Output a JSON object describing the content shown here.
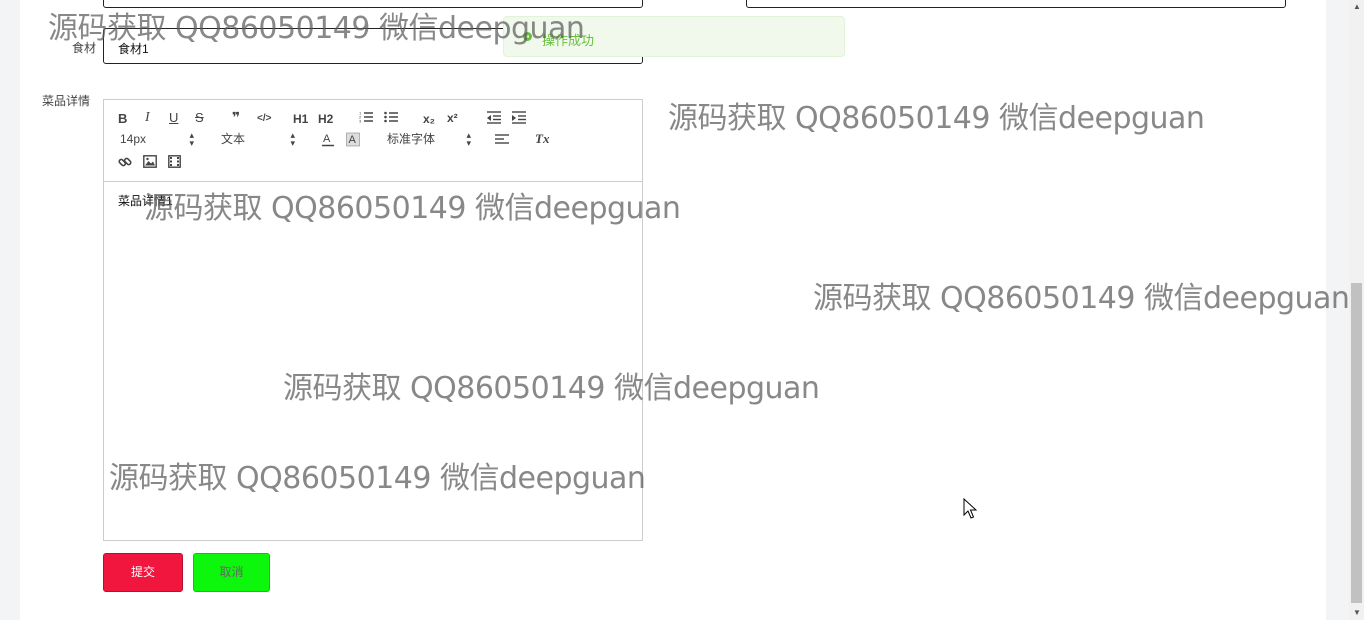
{
  "form": {
    "ingredient_label": "食材",
    "ingredient_value": "食材1",
    "details_label": "菜品详情",
    "editor_content": "菜品详情1"
  },
  "toolbar": {
    "bold": "B",
    "italic": "I",
    "underline": "U",
    "strike": "S",
    "quote": "❞",
    "code": "</>",
    "h1": "H1",
    "h2": "H2",
    "sub": "x₂",
    "sup": "x²",
    "font_size": "14px",
    "text_style": "文本",
    "font_family": "标准字体",
    "clear_format": "Tx"
  },
  "buttons": {
    "submit": "提交",
    "cancel": "取消"
  },
  "toast": {
    "message": "操作成功",
    "color": "#67c23a"
  },
  "watermark": "源码获取 QQ86050149 微信deepguan",
  "colors": {
    "submit_bg": "#f0163d",
    "cancel_bg": "#0cf70c"
  }
}
